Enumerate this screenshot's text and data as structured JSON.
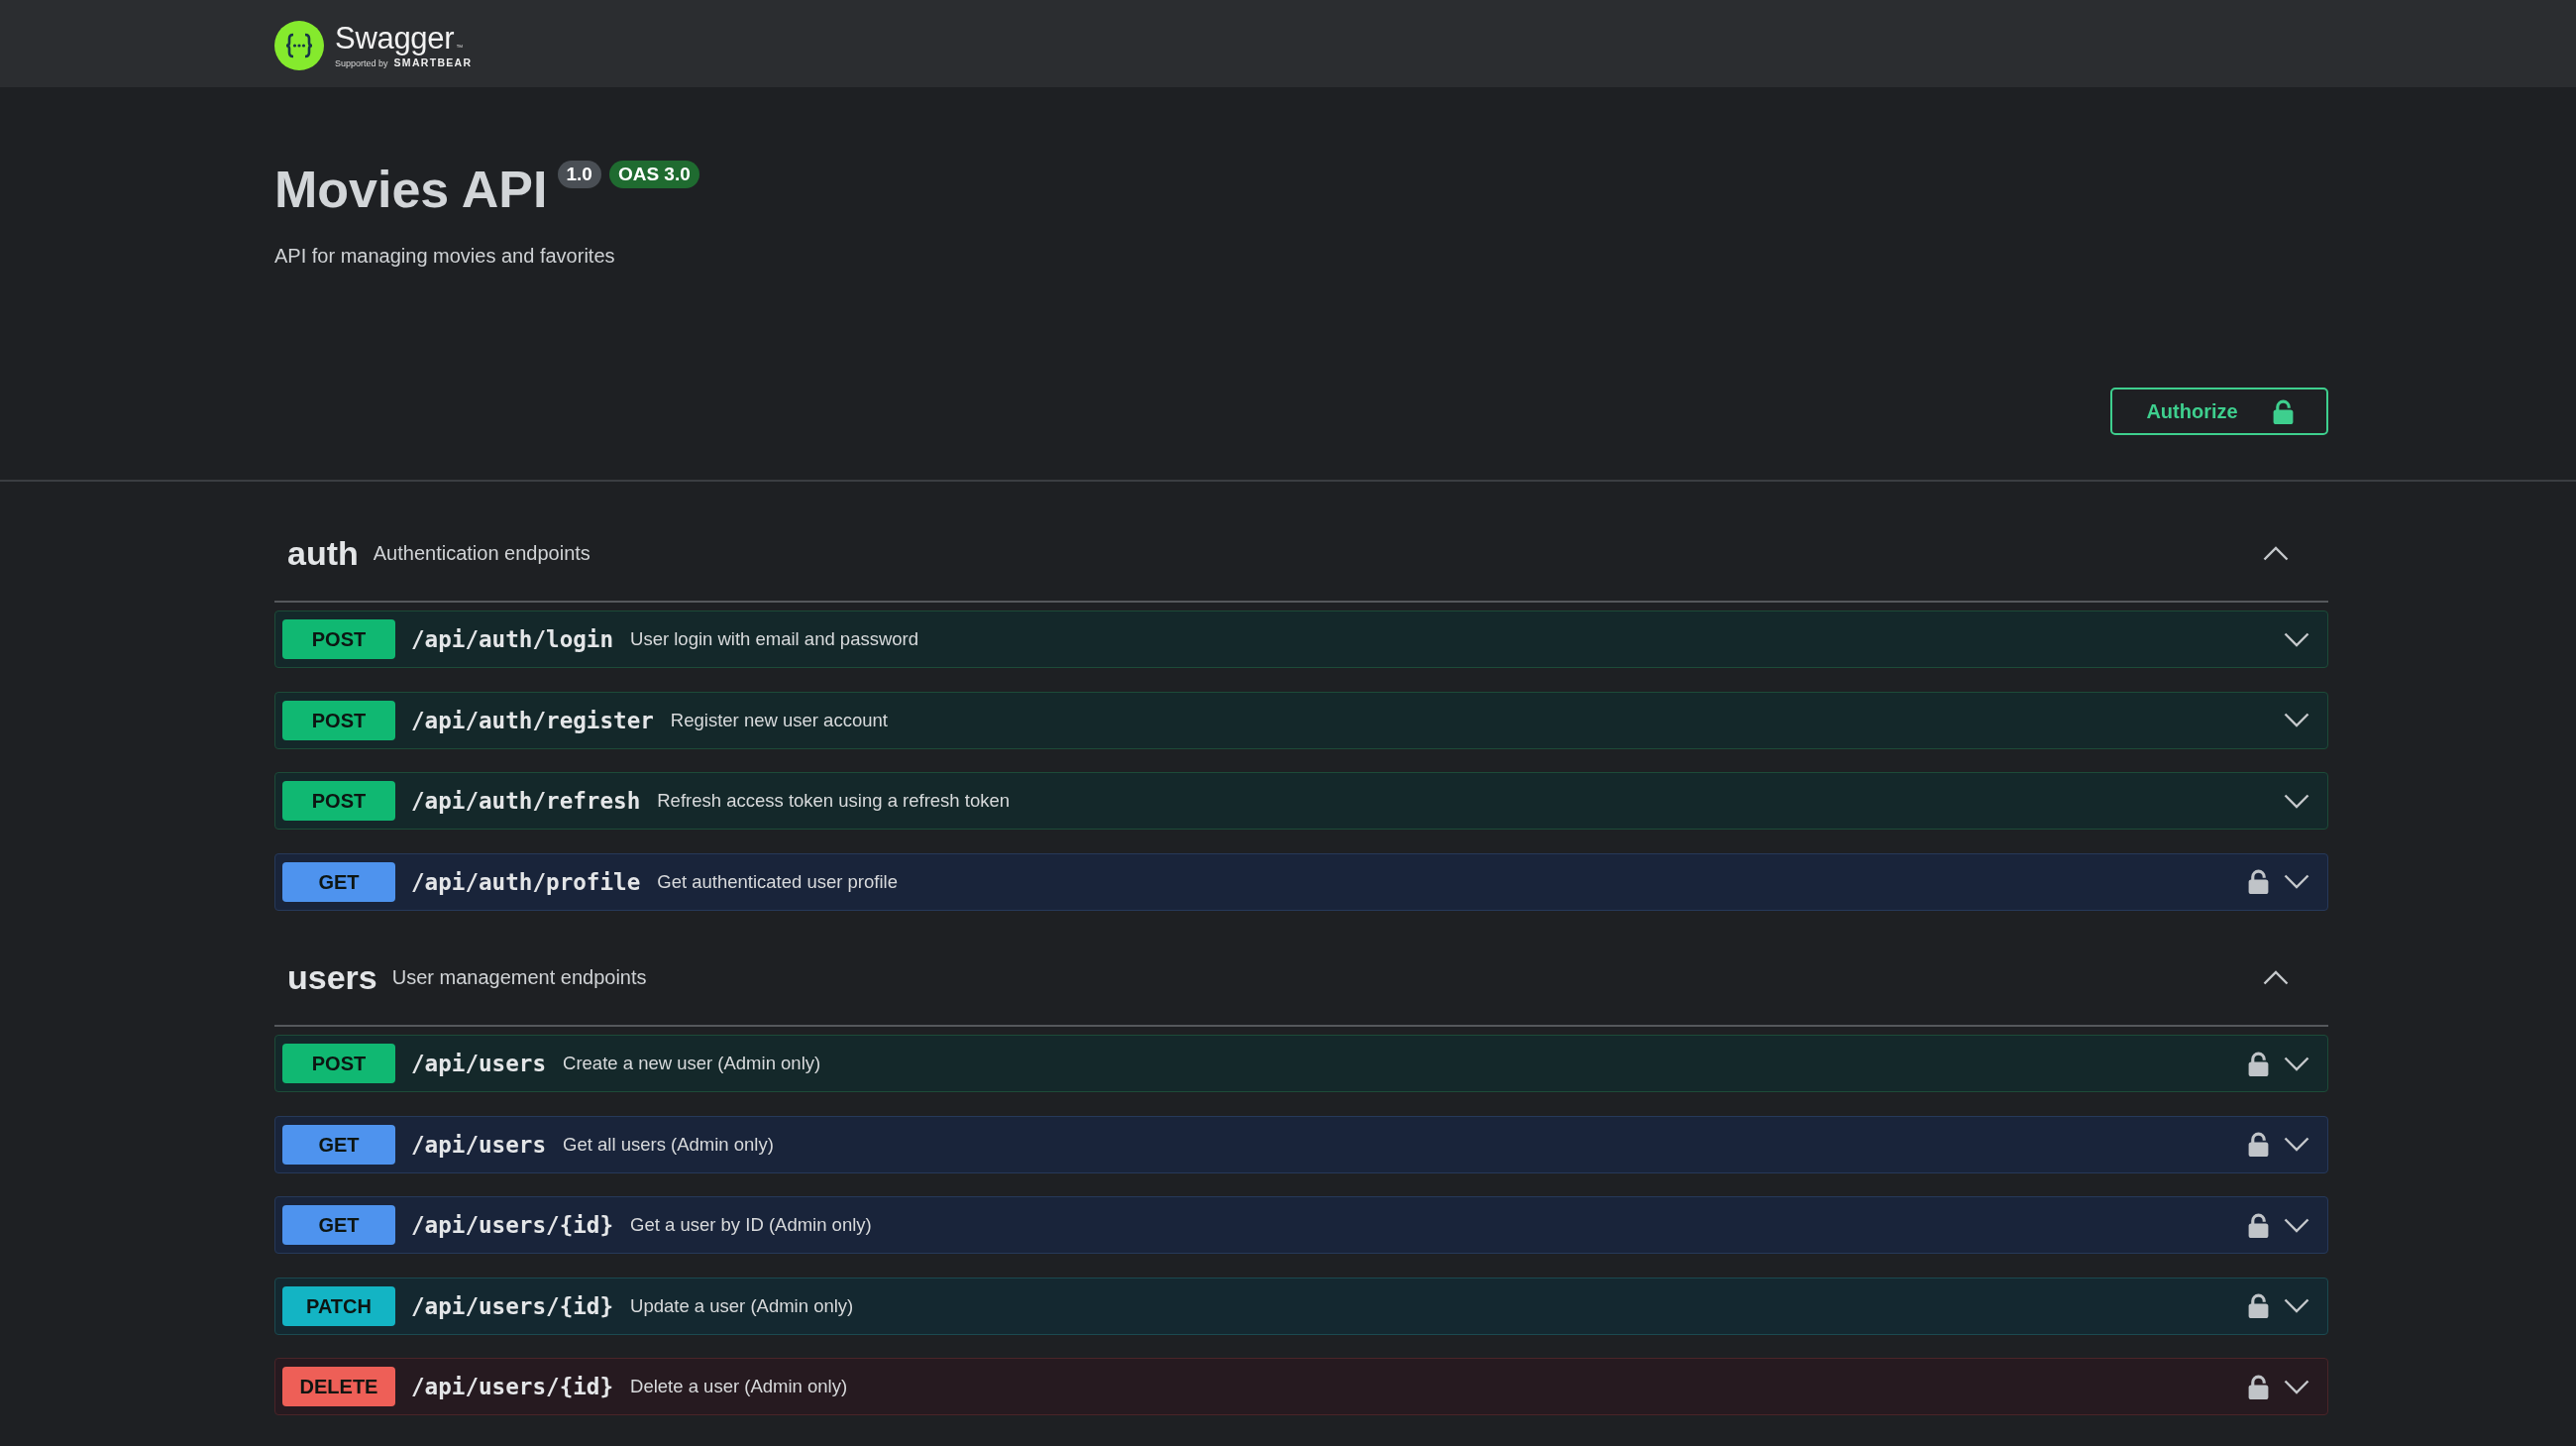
{
  "topbar": {
    "brand": "Swagger",
    "trademark": "™",
    "tagline": "Supported by",
    "sponsor": "SMARTBEAR"
  },
  "info": {
    "title": "Movies API",
    "version": "1.0",
    "spec": "OAS 3.0",
    "description": "API for managing movies and favorites"
  },
  "authorize": {
    "label": "Authorize",
    "authorized": false
  },
  "tags": [
    {
      "name": "auth",
      "description": "Authentication endpoints",
      "expanded": true,
      "operations": [
        {
          "method": "POST",
          "kind": "post",
          "path": "/api/auth/login",
          "summary": "User login with email and password",
          "secured": false,
          "expanded": false
        },
        {
          "method": "POST",
          "kind": "post",
          "path": "/api/auth/register",
          "summary": "Register new user account",
          "secured": false,
          "expanded": false
        },
        {
          "method": "POST",
          "kind": "post",
          "path": "/api/auth/refresh",
          "summary": "Refresh access token using a refresh token",
          "secured": false,
          "expanded": false
        },
        {
          "method": "GET",
          "kind": "get",
          "path": "/api/auth/profile",
          "summary": "Get authenticated user profile",
          "secured": true,
          "expanded": false
        }
      ]
    },
    {
      "name": "users",
      "description": "User management endpoints",
      "expanded": true,
      "operations": [
        {
          "method": "POST",
          "kind": "post",
          "path": "/api/users",
          "summary": "Create a new user (Admin only)",
          "secured": true,
          "expanded": false
        },
        {
          "method": "GET",
          "kind": "get",
          "path": "/api/users",
          "summary": "Get all users (Admin only)",
          "secured": true,
          "expanded": false
        },
        {
          "method": "GET",
          "kind": "get",
          "path": "/api/users/{id}",
          "summary": "Get a user by ID (Admin only)",
          "secured": true,
          "expanded": false
        },
        {
          "method": "PATCH",
          "kind": "patch",
          "path": "/api/users/{id}",
          "summary": "Update a user (Admin only)",
          "secured": true,
          "expanded": false
        },
        {
          "method": "DELETE",
          "kind": "delete",
          "path": "/api/users/{id}",
          "summary": "Delete a user (Admin only)",
          "secured": true,
          "expanded": false
        }
      ]
    }
  ]
}
